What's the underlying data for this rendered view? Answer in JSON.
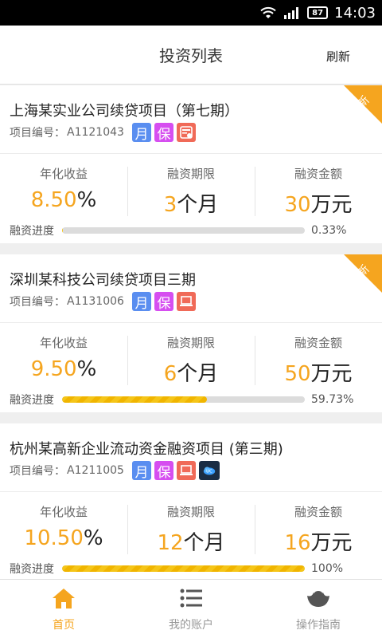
{
  "status_bar": {
    "battery": "87",
    "time": "14:03"
  },
  "header": {
    "title": "投资列表",
    "refresh": "刷新"
  },
  "colors": {
    "accent": "#f5a51f",
    "tag_month": "#5a8ef0",
    "tag_bao": "#d64ef0",
    "tag_red": "#f06a58",
    "tag_dark": "#1a2d44"
  },
  "labels": {
    "code_prefix": "项目编号：",
    "rate": "年化收益",
    "term": "融资期限",
    "amount": "融资金额",
    "progress": "融资进度",
    "tag_month": "月",
    "tag_bao": "保",
    "ribbon": "最新"
  },
  "projects": [
    {
      "name": "上海某实业公司续贷项目（第七期）",
      "code": "A1121043",
      "tags": [
        "month-tag",
        "bao-tag",
        "bank-icon"
      ],
      "is_new": true,
      "rate_num": "8.50",
      "rate_unit": "%",
      "term_num": "3",
      "term_unit": "个月",
      "amount_num": "30",
      "amount_unit": "万元",
      "progress": 0.33,
      "progress_text": "0.33%"
    },
    {
      "name": "深圳某科技公司续贷项目三期",
      "code": "A1131006",
      "tags": [
        "month-tag",
        "bao-tag",
        "laptop-icon"
      ],
      "is_new": true,
      "rate_num": "9.50",
      "rate_unit": "%",
      "term_num": "6",
      "term_unit": "个月",
      "amount_num": "50",
      "amount_unit": "万元",
      "progress": 59.73,
      "progress_text": "59.73%"
    },
    {
      "name": "杭州某高新企业流动资金融资项目 (第三期)",
      "code": "A1211005",
      "tags": [
        "month-tag",
        "bao-tag",
        "laptop-icon",
        "cloud-icon"
      ],
      "is_new": false,
      "rate_num": "10.50",
      "rate_unit": "%",
      "term_num": "12",
      "term_unit": "个月",
      "amount_num": "16",
      "amount_unit": "万元",
      "progress": 100,
      "progress_text": "100%"
    }
  ],
  "tabbar": {
    "items": [
      {
        "label": "首页",
        "icon": "home-icon",
        "active": true
      },
      {
        "label": "我的账户",
        "icon": "list-icon",
        "active": false
      },
      {
        "label": "操作指南",
        "icon": "ingot-icon",
        "active": false
      }
    ]
  }
}
